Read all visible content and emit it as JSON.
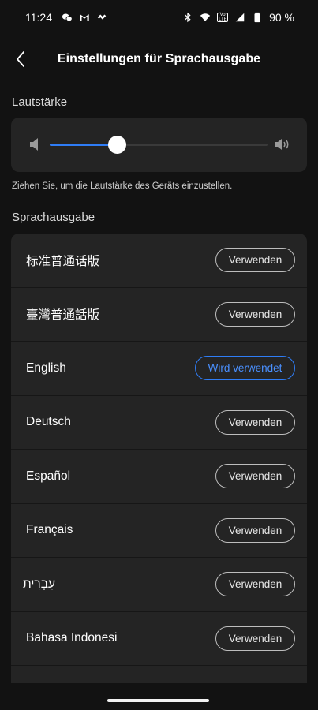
{
  "status_bar": {
    "time": "11:24",
    "battery_percent": "90 %",
    "lte_badge": [
      "Vo",
      "LTE"
    ],
    "icons": [
      "wechat-icon",
      "gmail-icon",
      "app-notification-icon",
      "bluetooth-icon",
      "wifi-icon",
      "volte-icon",
      "signal-icon",
      "battery-icon"
    ]
  },
  "header": {
    "title": "Einstellungen für Sprachausgabe",
    "back_icon": "chevron-left-icon"
  },
  "volume": {
    "section_title": "Lautstärke",
    "level": 0.31,
    "hint": "Ziehen Sie, um die Lautstärke des Geräts einzustellen.",
    "accent_color": "#2f7df6"
  },
  "voices": {
    "section_title": "Sprachausgabe",
    "items": [
      {
        "name": "标准普通话版",
        "button": "Verwenden",
        "active": false
      },
      {
        "name": "臺灣普通話版",
        "button": "Verwenden",
        "active": false
      },
      {
        "name": "English",
        "button": "Wird verwendet",
        "active": true
      },
      {
        "name": "Deutsch",
        "button": "Verwenden",
        "active": false
      },
      {
        "name": "Español",
        "button": "Verwenden",
        "active": false
      },
      {
        "name": "Français",
        "button": "Verwenden",
        "active": false
      },
      {
        "name": "עִבְרִית",
        "button": "Verwenden",
        "active": false
      },
      {
        "name": "Bahasa Indonesi",
        "button": "Verwenden",
        "active": false
      }
    ]
  }
}
